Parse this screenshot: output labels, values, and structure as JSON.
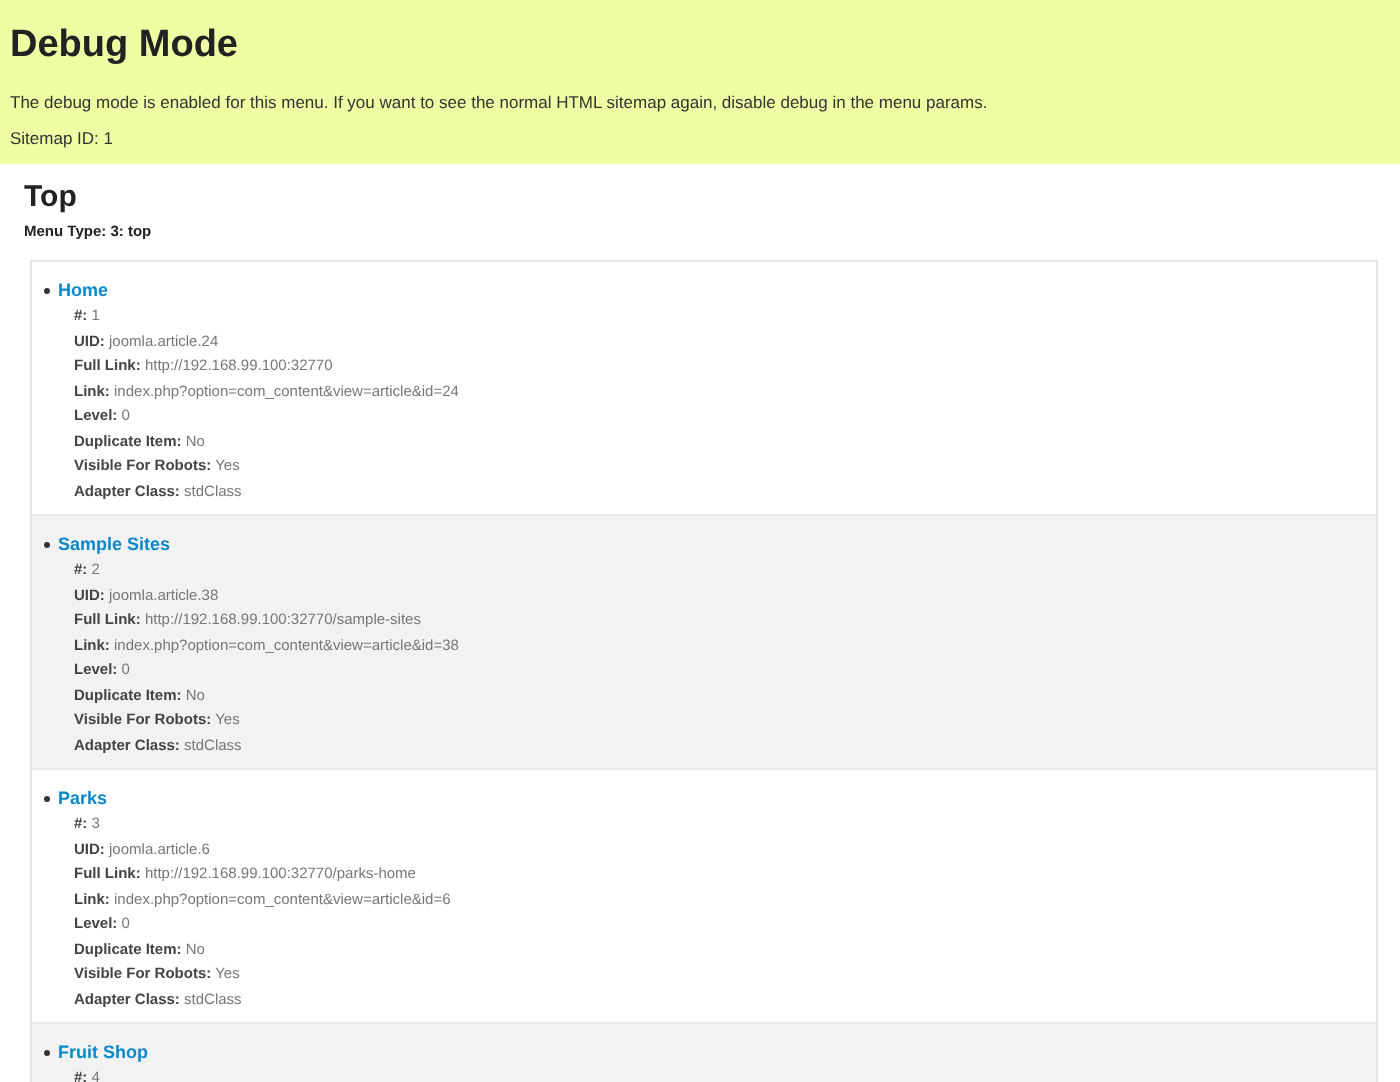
{
  "banner": {
    "title": "Debug Mode",
    "message": "The debug mode is enabled for this menu. If you want to see the normal HTML sitemap again, disable debug in the menu params.",
    "sitemap_id": "Sitemap ID: 1"
  },
  "menu": {
    "title": "Top",
    "menu_type": "Menu Type: 3: top",
    "items": [
      {
        "title": "Home",
        "details": [
          {
            "label": "#:",
            "value": "1"
          },
          {
            "label": "UID:",
            "value": "joomla.article.24"
          },
          {
            "label": "Full Link:",
            "value": "http://192.168.99.100:32770"
          },
          {
            "label": "Link:",
            "value": "index.php?option=com_content&view=article&id=24"
          },
          {
            "label": "Level:",
            "value": "0"
          },
          {
            "label": "Duplicate Item:",
            "value": "No"
          },
          {
            "label": "Visible For Robots:",
            "value": "Yes"
          },
          {
            "label": "Adapter Class:",
            "value": "stdClass"
          }
        ]
      },
      {
        "title": "Sample Sites",
        "details": [
          {
            "label": "#:",
            "value": "2"
          },
          {
            "label": "UID:",
            "value": "joomla.article.38"
          },
          {
            "label": "Full Link:",
            "value": "http://192.168.99.100:32770/sample-sites"
          },
          {
            "label": "Link:",
            "value": "index.php?option=com_content&view=article&id=38"
          },
          {
            "label": "Level:",
            "value": "0"
          },
          {
            "label": "Duplicate Item:",
            "value": "No"
          },
          {
            "label": "Visible For Robots:",
            "value": "Yes"
          },
          {
            "label": "Adapter Class:",
            "value": "stdClass"
          }
        ]
      },
      {
        "title": "Parks",
        "details": [
          {
            "label": "#:",
            "value": "3"
          },
          {
            "label": "UID:",
            "value": "joomla.article.6"
          },
          {
            "label": "Full Link:",
            "value": "http://192.168.99.100:32770/parks-home"
          },
          {
            "label": "Link:",
            "value": "index.php?option=com_content&view=article&id=6"
          },
          {
            "label": "Level:",
            "value": "0"
          },
          {
            "label": "Duplicate Item:",
            "value": "No"
          },
          {
            "label": "Visible For Robots:",
            "value": "Yes"
          },
          {
            "label": "Adapter Class:",
            "value": "stdClass"
          }
        ]
      },
      {
        "title": "Fruit Shop",
        "details": [
          {
            "label": "#:",
            "value": "4"
          }
        ]
      }
    ]
  }
}
